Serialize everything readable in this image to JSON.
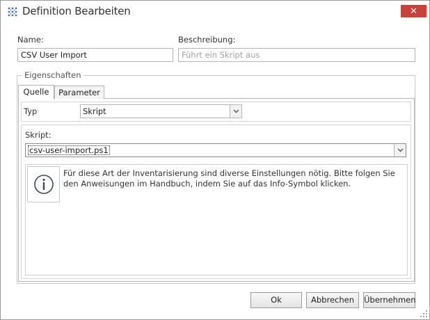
{
  "window": {
    "title": "Definition Bearbeiten",
    "close_glyph": "✕"
  },
  "form": {
    "name_label": "Name:",
    "name_value": "CSV User Import",
    "description_label": "Beschreibung:",
    "description_placeholder": "Führt ein Skript aus"
  },
  "properties": {
    "group_label": "Eigenschaften",
    "tabs": [
      {
        "label": "Quelle",
        "active": true
      },
      {
        "label": "Parameter",
        "active": false
      }
    ],
    "type_label": "Typ",
    "type_value": "Skript",
    "script_label": "Skript:",
    "script_value": "csv-user-import.ps1",
    "info_text": "Für diese Art der Inventarisierung sind diverse Einstellungen nötig. Bitte folgen Sie den Anweisungen im Handbuch, indem Sie auf das Info-Symbol klicken."
  },
  "buttons": {
    "ok": "Ok",
    "cancel": "Abbrechen",
    "apply": "Übernehmen"
  },
  "colors": {
    "close_button": "#c7423a",
    "app_icon": "#4a6fb0"
  },
  "icons": {
    "app": "grid-dots-icon",
    "close": "close-icon",
    "info": "info-icon",
    "dropdown": "chevron-down-icon"
  }
}
